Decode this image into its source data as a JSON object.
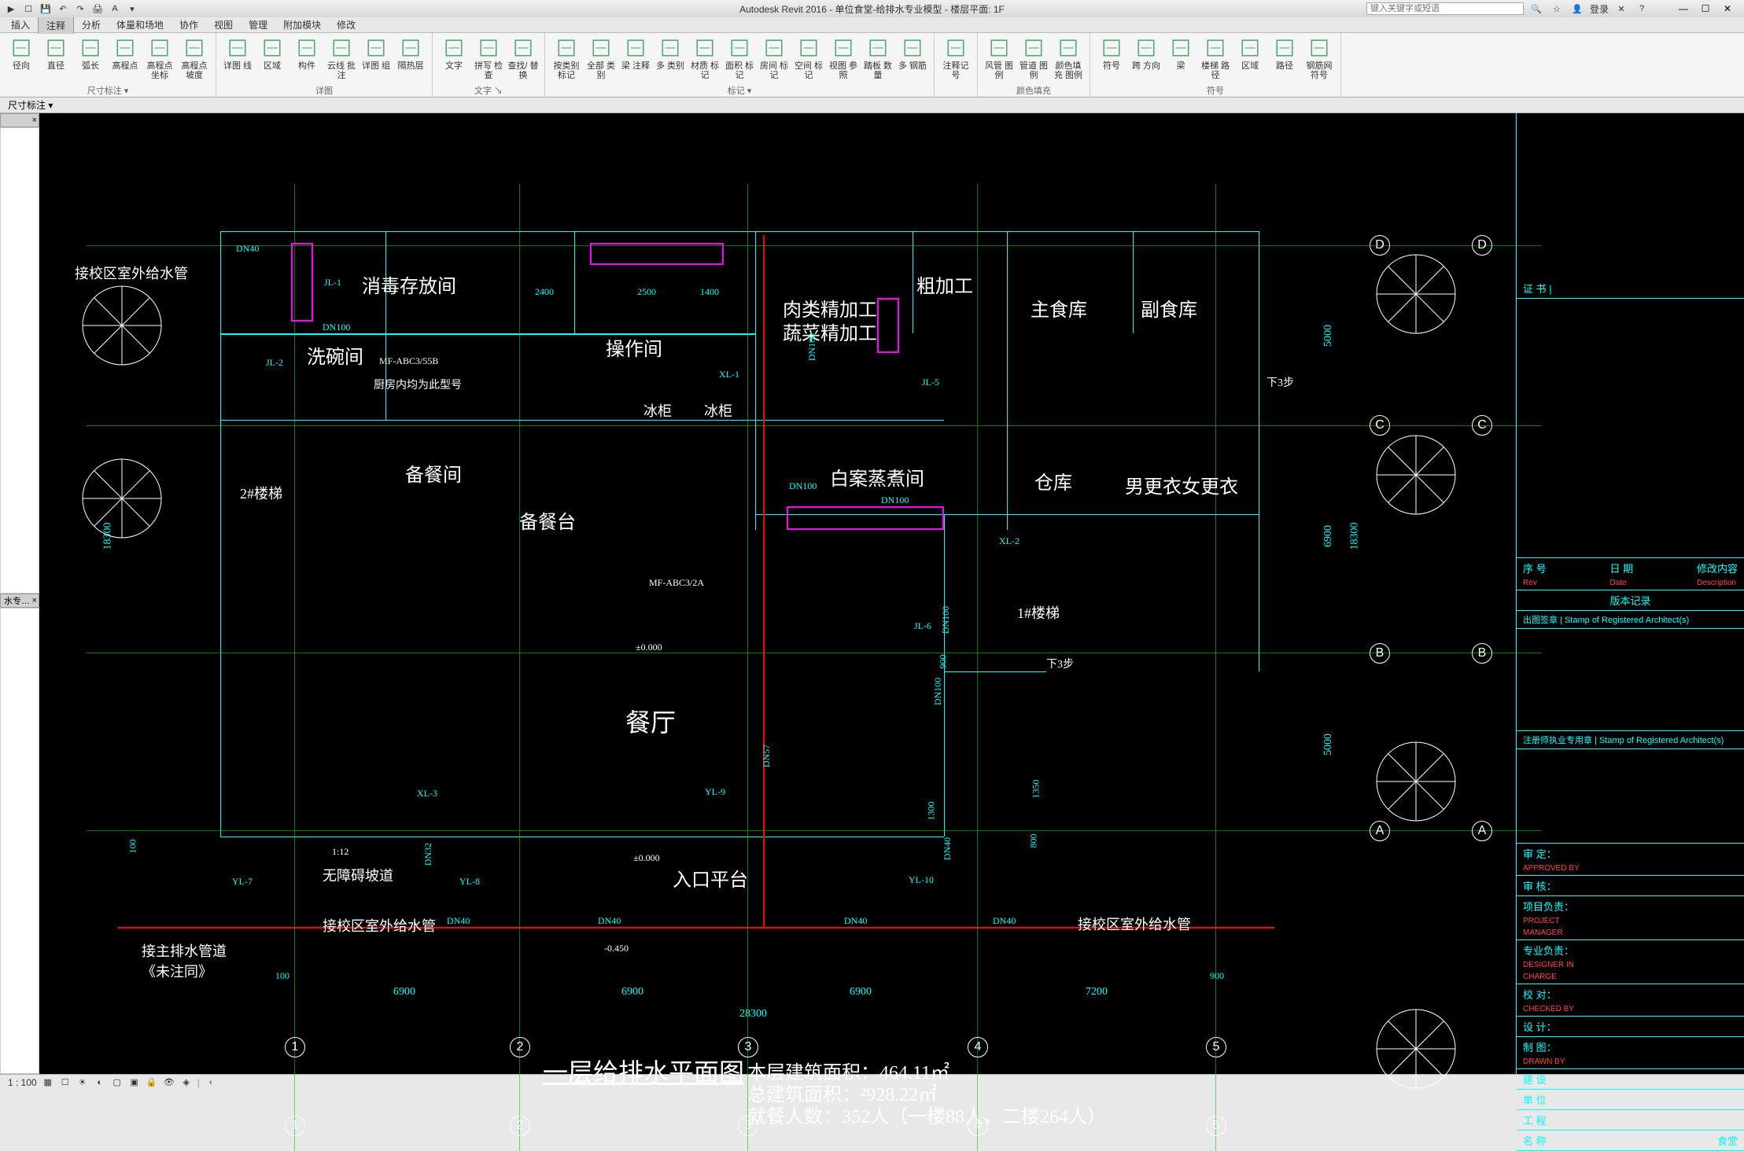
{
  "app": {
    "title": "Autodesk Revit 2016 - 单位食堂-给排水专业模型 - 楼层平面: 1F",
    "search_placeholder": "键入关键字或短语",
    "login": "登录"
  },
  "menu_tabs": [
    "插入",
    "注释",
    "分析",
    "体量和场地",
    "协作",
    "视图",
    "管理",
    "附加模块",
    "修改"
  ],
  "active_tab": 1,
  "ribbon": {
    "groups": [
      {
        "label": "尺寸标注 ▾",
        "btns": [
          {
            "name": "aligned",
            "label": "径向"
          },
          {
            "name": "linear",
            "label": "直径"
          },
          {
            "name": "angular",
            "label": "弧长"
          },
          {
            "name": "spot-elev",
            "label": "高程点"
          },
          {
            "name": "spot-coord",
            "label": "高程点\n坐标"
          },
          {
            "name": "spot-slope",
            "label": "高程点\n坡度"
          }
        ]
      },
      {
        "label": "详图",
        "btns": [
          {
            "name": "detail-line",
            "label": "详图\n线"
          },
          {
            "name": "region",
            "label": "区域"
          },
          {
            "name": "component",
            "label": "构件"
          },
          {
            "name": "revision-cloud",
            "label": "云线\n批注"
          },
          {
            "name": "detail-group",
            "label": "详图\n组"
          },
          {
            "name": "insulation",
            "label": "隔热层"
          }
        ]
      },
      {
        "label": "文字 ↘",
        "btns": [
          {
            "name": "text",
            "label": "文字"
          },
          {
            "name": "spell",
            "label": "拼写\n检查"
          },
          {
            "name": "find",
            "label": "查找/\n替换"
          }
        ]
      },
      {
        "label": "标记 ▾",
        "btns": [
          {
            "name": "tag-category",
            "label": "按类别\n标记"
          },
          {
            "name": "tag-all",
            "label": "全部\n类别"
          },
          {
            "name": "beam-tag",
            "label": "梁\n注释"
          },
          {
            "name": "multi-tag",
            "label": "多\n类别"
          },
          {
            "name": "material-tag",
            "label": "材质\n标记"
          },
          {
            "name": "area-tag",
            "label": "面积\n标记"
          },
          {
            "name": "room-tag",
            "label": "房间\n标记"
          },
          {
            "name": "space-tag",
            "label": "空间\n标记"
          },
          {
            "name": "view-ref",
            "label": "视图\n参照"
          },
          {
            "name": "tread-num",
            "label": "踏板\n数量"
          },
          {
            "name": "multi-rebar",
            "label": "多\n钢筋"
          }
        ]
      },
      {
        "label": "",
        "btns": [
          {
            "name": "keynote",
            "label": "注释记号"
          }
        ]
      },
      {
        "label": "颜色填充",
        "btns": [
          {
            "name": "duct-legend",
            "label": "风管\n图例"
          },
          {
            "name": "pipe-legend",
            "label": "管道\n图例"
          },
          {
            "name": "color-fill",
            "label": "颜色填充\n图例"
          }
        ]
      },
      {
        "label": "符号",
        "btns": [
          {
            "name": "symbol",
            "label": "符号"
          },
          {
            "name": "span-dir",
            "label": "跨\n方向"
          },
          {
            "name": "beam-sys",
            "label": "梁"
          },
          {
            "name": "stair-path",
            "label": "楼梯\n路径"
          },
          {
            "name": "area-rein",
            "label": "区域"
          },
          {
            "name": "path-rein",
            "label": "路径"
          },
          {
            "name": "fabric-rein",
            "label": "钢筋网\n符号"
          }
        ]
      }
    ]
  },
  "options_bar": "尺寸标注 ▾",
  "view_scale": "1 : 100",
  "drawing": {
    "title": "一层给排水平面图",
    "info1": "本层建筑面积：464.11㎡",
    "info2": "总建筑面积：²928.22㎡",
    "info3": "就餐人数：352人（一楼88人，二楼264人）",
    "rooms": {
      "disinfect": "消毒存放间",
      "wash": "洗碗间",
      "operate": "操作间",
      "meat": "肉类精加工",
      "veg": "蔬菜精加工",
      "rough": "粗加工",
      "mainfood": "主食库",
      "sidefood": "副食库",
      "prep": "备餐间",
      "preptable": "备餐台",
      "fridge1": "冰柜",
      "fridge2": "冰柜",
      "steam": "白案蒸煮间",
      "warehouse": "仓库",
      "change": "男更衣女更衣",
      "dining": "餐厅",
      "ramp": "无障碍坡道",
      "entry": "入口平台",
      "stair1": "1#楼梯",
      "stair2": "2#楼梯",
      "kitchen_note": "厨房内均为此型号",
      "step3a": "下3步",
      "step3b": "下3步"
    },
    "notes": {
      "pipe_in": "接校区室外给水管",
      "pipe_out": "接主排水管道\n《未注同》",
      "pipe_in2": "接校区室外给水管",
      "pipe_in3": "接校区室外给水管"
    },
    "pipe_labels": [
      "DN40",
      "DN100",
      "DN100",
      "DN100",
      "DN32",
      "DN40",
      "DN40",
      "DN40",
      "DN57",
      "DN100",
      "DN100",
      "DN40",
      "DN100",
      "DN40"
    ],
    "callouts": [
      "JL-1",
      "JL-2",
      "XL-1",
      "JL-5",
      "XL-2",
      "JL-6",
      "XL-3",
      "YL-7",
      "YL-8",
      "YL-9",
      "YL-10",
      "MF-ABC3/55B",
      "MF-ABC3/2A",
      "1:12"
    ],
    "dims": [
      "6900",
      "6900",
      "6900",
      "7200",
      "28300",
      "2400",
      "2500",
      "1400",
      "100",
      "900",
      "900",
      "5000",
      "5000",
      "6900",
      "18300",
      "1300",
      "18300",
      "800",
      "1350"
    ],
    "elevs": [
      "±0.000",
      "±0.000",
      "-0.450"
    ],
    "grids_h": [
      "A",
      "B",
      "C",
      "D"
    ],
    "grids_v": [
      "1",
      "2",
      "3",
      "4",
      "5"
    ]
  },
  "titleblock": {
    "cert": "证 书 |",
    "rev_hdr": [
      "序 号",
      "日 期",
      "修改内容"
    ],
    "rev_sub": [
      "Rev",
      "Date",
      "Description"
    ],
    "version": "版本记录",
    "stamp1": "出图签章 | Stamp of Registered Architect(s)",
    "stamp2": "注册师执业专用章 | Stamp of Registered Architect(s)",
    "rows": [
      {
        "c": "审 定：",
        "e": "APPROVED BY"
      },
      {
        "c": "审 核：",
        "e": ""
      },
      {
        "c": "项目负责：",
        "e": "PROJECT MANAGER"
      },
      {
        "c": "专业负责：",
        "e": "DESIGNER IN CHARGE"
      },
      {
        "c": "校 对：",
        "e": "CHECKED BY"
      },
      {
        "c": "设 计：",
        "e": ""
      },
      {
        "c": "制 图：",
        "e": "DRAWN BY"
      },
      {
        "c": "建 设",
        "e": ""
      },
      {
        "c": "单 位",
        "e": ""
      },
      {
        "c": "工 程",
        "e": ""
      },
      {
        "c": "名 称",
        "e": "",
        "v": "食堂"
      }
    ]
  }
}
